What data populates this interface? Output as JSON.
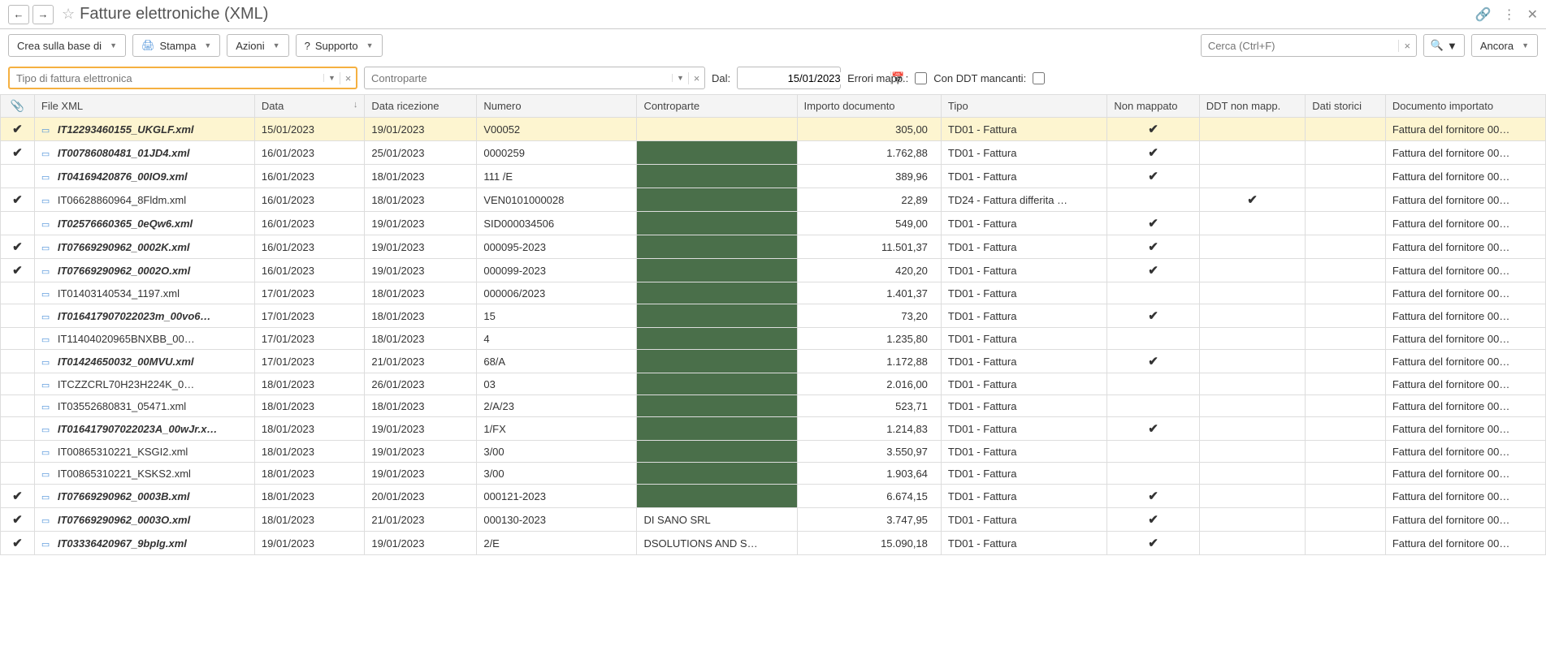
{
  "title": "Fatture elettroniche (XML)",
  "toolbar": {
    "crea": "Crea sulla base di",
    "stampa": "Stampa",
    "azioni": "Azioni",
    "supporto": "Supporto",
    "cerca_placeholder": "Cerca (Ctrl+F)",
    "ancora": "Ancora"
  },
  "filters": {
    "tipo_placeholder": "Tipo di fattura elettronica",
    "controparte_placeholder": "Controparte",
    "dal_label": "Dal:",
    "dal_value": "15/01/2023",
    "errori_label": "Errori mapp.:",
    "ddt_label": "Con DDT mancanti:"
  },
  "columns": {
    "file": "File XML",
    "data": "Data",
    "ricezione": "Data ricezione",
    "numero": "Numero",
    "controparte": "Controparte",
    "importo": "Importo documento",
    "tipo": "Tipo",
    "nonmapp": "Non mappato",
    "ddtnonmapp": "DDT non mapp.",
    "datistorici": "Dati storici",
    "docimport": "Documento importato"
  },
  "rows": [
    {
      "chk": true,
      "file": "IT12293460155_UKGLF.xml",
      "bold": true,
      "data": "15/01/2023",
      "ric": "19/01/2023",
      "num": "V00052",
      "cpt": "",
      "red": true,
      "imp": "305,00",
      "tipo": "TD01 - Fattura",
      "map": true,
      "ddt": false,
      "doc": "Fattura del fornitore 00…",
      "sel": true
    },
    {
      "chk": true,
      "file": "IT00786080481_01JD4.xml",
      "bold": true,
      "data": "16/01/2023",
      "ric": "25/01/2023",
      "num": "0000259",
      "cpt": "",
      "red": true,
      "imp": "1.762,88",
      "tipo": "TD01 - Fattura",
      "map": true,
      "ddt": false,
      "doc": "Fattura del fornitore 00…"
    },
    {
      "chk": false,
      "file": "IT04169420876_00IO9.xml",
      "bold": true,
      "data": "16/01/2023",
      "ric": "18/01/2023",
      "num": "111 /E",
      "cpt": "",
      "red": true,
      "imp": "389,96",
      "tipo": "TD01 - Fattura",
      "map": true,
      "ddt": false,
      "doc": "Fattura del fornitore 00…"
    },
    {
      "chk": true,
      "file": "IT06628860964_8Fldm.xml",
      "bold": false,
      "data": "16/01/2023",
      "ric": "18/01/2023",
      "num": "VEN0101000028",
      "cpt": "",
      "red": true,
      "imp": "22,89",
      "tipo": "TD24 - Fattura differita …",
      "map": false,
      "ddt": true,
      "doc": "Fattura del fornitore 00…"
    },
    {
      "chk": false,
      "file": "IT02576660365_0eQw6.xml",
      "bold": true,
      "data": "16/01/2023",
      "ric": "19/01/2023",
      "num": "SID000034506",
      "cpt": "",
      "red": true,
      "imp": "549,00",
      "tipo": "TD01 - Fattura",
      "map": true,
      "ddt": false,
      "doc": "Fattura del fornitore 00…"
    },
    {
      "chk": true,
      "file": "IT07669290962_0002K.xml",
      "bold": true,
      "data": "16/01/2023",
      "ric": "19/01/2023",
      "num": "000095-2023",
      "cpt": "",
      "red": true,
      "imp": "11.501,37",
      "tipo": "TD01 - Fattura",
      "map": true,
      "ddt": false,
      "doc": "Fattura del fornitore 00…"
    },
    {
      "chk": true,
      "file": "IT07669290962_0002O.xml",
      "bold": true,
      "data": "16/01/2023",
      "ric": "19/01/2023",
      "num": "000099-2023",
      "cpt": "",
      "red": true,
      "imp": "420,20",
      "tipo": "TD01 - Fattura",
      "map": true,
      "ddt": false,
      "doc": "Fattura del fornitore 00…"
    },
    {
      "chk": false,
      "file": "IT01403140534_1197.xml",
      "bold": false,
      "data": "17/01/2023",
      "ric": "18/01/2023",
      "num": "000006/2023",
      "cpt": "",
      "red": true,
      "imp": "1.401,37",
      "tipo": "TD01 - Fattura",
      "map": false,
      "ddt": false,
      "doc": "Fattura del fornitore 00…"
    },
    {
      "chk": false,
      "file": "IT016417907022023m_00vo6…",
      "bold": true,
      "data": "17/01/2023",
      "ric": "18/01/2023",
      "num": "15",
      "cpt": "",
      "red": true,
      "imp": "73,20",
      "tipo": "TD01 - Fattura",
      "map": true,
      "ddt": false,
      "doc": "Fattura del fornitore 00…"
    },
    {
      "chk": false,
      "file": "IT11404020965BNXBB_00…",
      "bold": false,
      "data": "17/01/2023",
      "ric": "18/01/2023",
      "num": "4",
      "cpt": "",
      "red": true,
      "imp": "1.235,80",
      "tipo": "TD01 - Fattura",
      "map": false,
      "ddt": false,
      "doc": "Fattura del fornitore 00…"
    },
    {
      "chk": false,
      "file": "IT01424650032_00MVU.xml",
      "bold": true,
      "data": "17/01/2023",
      "ric": "21/01/2023",
      "num": "68/A",
      "cpt": "",
      "red": true,
      "imp": "1.172,88",
      "tipo": "TD01 - Fattura",
      "map": true,
      "ddt": false,
      "doc": "Fattura del fornitore 00…"
    },
    {
      "chk": false,
      "file": "ITCZZCRL70H23H224K_0…",
      "bold": false,
      "data": "18/01/2023",
      "ric": "26/01/2023",
      "num": "03",
      "cpt": "",
      "red": true,
      "imp": "2.016,00",
      "tipo": "TD01 - Fattura",
      "map": false,
      "ddt": false,
      "doc": "Fattura del fornitore 00…"
    },
    {
      "chk": false,
      "file": "IT03552680831_05471.xml",
      "bold": false,
      "data": "18/01/2023",
      "ric": "18/01/2023",
      "num": "2/A/23",
      "cpt": "",
      "red": true,
      "imp": "523,71",
      "tipo": "TD01 - Fattura",
      "map": false,
      "ddt": false,
      "doc": "Fattura del fornitore 00…"
    },
    {
      "chk": false,
      "file": "IT016417907022023A_00wJr.x…",
      "bold": true,
      "data": "18/01/2023",
      "ric": "19/01/2023",
      "num": "1/FX",
      "cpt": "",
      "red": true,
      "imp": "1.214,83",
      "tipo": "TD01 - Fattura",
      "map": true,
      "ddt": false,
      "doc": "Fattura del fornitore 00…"
    },
    {
      "chk": false,
      "file": "IT00865310221_KSGI2.xml",
      "bold": false,
      "data": "18/01/2023",
      "ric": "19/01/2023",
      "num": "3/00",
      "cpt": "",
      "red": true,
      "imp": "3.550,97",
      "tipo": "TD01 - Fattura",
      "map": false,
      "ddt": false,
      "doc": "Fattura del fornitore 00…"
    },
    {
      "chk": false,
      "file": "IT00865310221_KSKS2.xml",
      "bold": false,
      "data": "18/01/2023",
      "ric": "19/01/2023",
      "num": "3/00",
      "cpt": "",
      "red": true,
      "imp": "1.903,64",
      "tipo": "TD01 - Fattura",
      "map": false,
      "ddt": false,
      "doc": "Fattura del fornitore 00…"
    },
    {
      "chk": true,
      "file": "IT07669290962_0003B.xml",
      "bold": true,
      "data": "18/01/2023",
      "ric": "20/01/2023",
      "num": "000121-2023",
      "cpt": "",
      "red": true,
      "imp": "6.674,15",
      "tipo": "TD01 - Fattura",
      "map": true,
      "ddt": false,
      "doc": "Fattura del fornitore 00…"
    },
    {
      "chk": true,
      "file": "IT07669290962_0003O.xml",
      "bold": true,
      "data": "18/01/2023",
      "ric": "21/01/2023",
      "num": "000130-2023",
      "cpt": "DI SANO SRL",
      "red": false,
      "imp": "3.747,95",
      "tipo": "TD01 - Fattura",
      "map": true,
      "ddt": false,
      "doc": "Fattura del fornitore 00…"
    },
    {
      "chk": true,
      "file": "IT03336420967_9bpIg.xml",
      "bold": true,
      "data": "19/01/2023",
      "ric": "19/01/2023",
      "num": "2/E",
      "cpt": "DSOLUTIONS AND S…",
      "red": false,
      "imp": "15.090,18",
      "tipo": "TD01 - Fattura",
      "map": true,
      "ddt": false,
      "doc": "Fattura del fornitore 00…"
    }
  ]
}
